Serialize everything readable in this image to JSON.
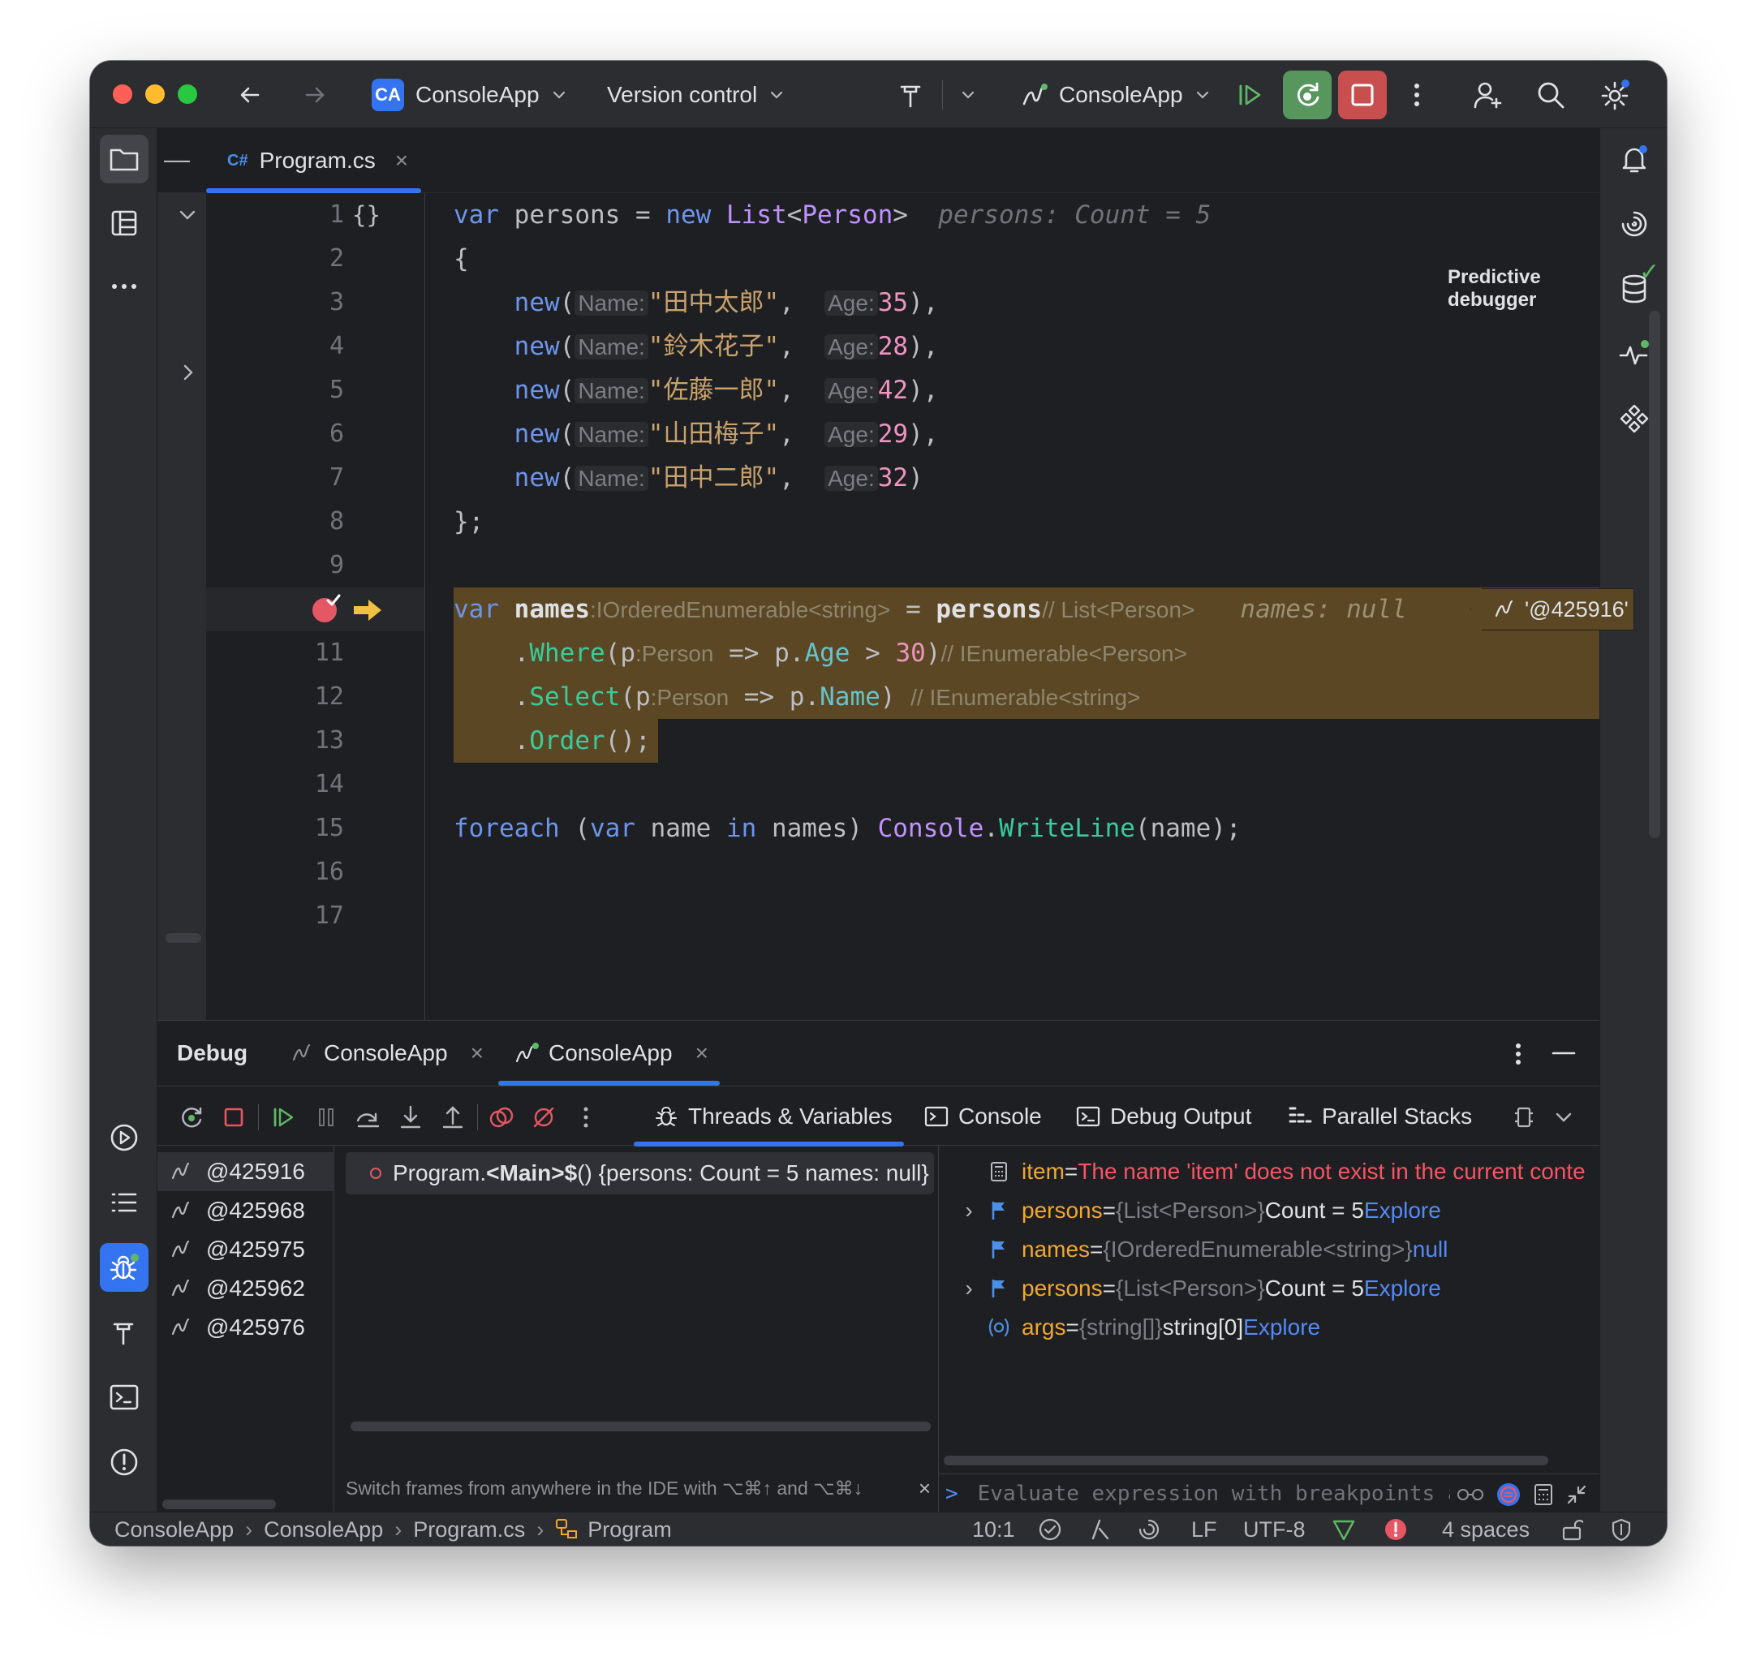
{
  "titlebar": {
    "project_badge": "CA",
    "project_name": "ConsoleApp",
    "vcs_label": "Version control",
    "run_config": "ConsoleApp"
  },
  "editor": {
    "tab_lang": "C#",
    "tab_name": "Program.cs",
    "tab_close": "×",
    "predictive_label": "Predictive debugger",
    "line_numbers": [
      "1",
      "2",
      "3",
      "4",
      "5",
      "6",
      "7",
      "8",
      "9",
      "",
      "11",
      "12",
      "13",
      "14",
      "15",
      "16",
      "17"
    ],
    "braces_marker": "{}",
    "thread_chip": "'@425916'",
    "code": {
      "l1_var": "var",
      "l1_name": " persons = ",
      "l1_new": "new",
      "l1_type1": " List",
      "l1_lt": "<",
      "l1_type2": "Person",
      "l1_gt": ">",
      "l1_val": "persons: Count = 5",
      "l2": "{",
      "rows": [
        {
          "s": "\"田中太郎\"",
          "n": "35",
          "end": "),"
        },
        {
          "s": "\"鈴木花子\"",
          "n": "28",
          "end": "),"
        },
        {
          "s": "\"佐藤一郎\"",
          "n": "42",
          "end": "),"
        },
        {
          "s": "\"山田梅子\"",
          "n": "29",
          "end": "),"
        },
        {
          "s": "\"田中二郎\"",
          "n": "32",
          "end": ")"
        }
      ],
      "new_kw": "new",
      "hint_name": "Name:",
      "hint_age": "Age:",
      "l8": "};",
      "l10_var": "var",
      "l10_name": " names",
      "l10_hint": ":IOrderedEnumerable<string>",
      "l10_eq": " = ",
      "l10_src": "persons",
      "l10_comment": "// List<Person>",
      "l10_val": "names: null",
      "l11_pre": "    .",
      "l11_m": "Where",
      "l11_a": "(p",
      "l11_hint": ":Person",
      "l11_b": " => p.",
      "l11_f": "Age",
      "l11_c": " > ",
      "l11_n": "30",
      "l11_d": ")",
      "l11_comment": "// IEnumerable<Person>",
      "l12_pre": "    .",
      "l12_m": "Select",
      "l12_a": "(p",
      "l12_hint": ":Person",
      "l12_b": " => p.",
      "l12_f": "Name",
      "l12_d": ")",
      "l12_comment": "// IEnumerable<string>",
      "l13_pre": "    .",
      "l13_m": "Order",
      "l13_d": "();",
      "l15_kw": "foreach",
      "l15_a": " (",
      "l15_var": "var",
      "l15_b": " name ",
      "l15_in": "in",
      "l15_c": " names) ",
      "l15_cls": "Console",
      "l15_dot": ".",
      "l15_m": "WriteLine",
      "l15_d": "(name);"
    }
  },
  "debug": {
    "title": "Debug",
    "tabs": [
      {
        "label": "ConsoleApp",
        "close": "×"
      },
      {
        "label": "ConsoleApp",
        "close": "×"
      }
    ],
    "view_tabs": [
      "Threads & Variables",
      "Console",
      "Debug Output",
      "Parallel Stacks"
    ],
    "threads": [
      "@425916",
      "@425968",
      "@425975",
      "@425962",
      "@425976"
    ],
    "frame": {
      "pre": "Program.",
      "main": "<Main>$",
      "post": "() {persons: Count = 5  names: null}"
    },
    "frame_hint": "Switch frames from anywhere in the IDE with ⌥⌘↑ and ⌥⌘↓",
    "frame_hint_close": "×",
    "variables": [
      {
        "name": "item",
        "eq": " = ",
        "err": "The name 'item' does not exist in the current conte"
      },
      {
        "name": "persons",
        "eq": " = ",
        "type": "{List<Person>}",
        "val": " Count = 5 ",
        "link": "Explore"
      },
      {
        "name": "names",
        "eq": " = ",
        "type": "{IOrderedEnumerable<string>}",
        "val": " ",
        "link": "null"
      },
      {
        "name": "persons",
        "eq": " = ",
        "type": "{List<Person>}",
        "val": " Count = 5 ",
        "link": "Explore"
      },
      {
        "name": "args",
        "eq": " = ",
        "type": "{string[]}",
        "val": " string[0] ",
        "link": "Explore"
      }
    ],
    "eval_prompt": ">",
    "eval_placeholder": "Evaluate expression with breakpoints and"
  },
  "statusbar": {
    "crumbs": [
      "ConsoleApp",
      "ConsoleApp",
      "Program.cs",
      "Program"
    ],
    "position": "10:1",
    "line_sep": "LF",
    "encoding": "UTF-8",
    "indent": "4 spaces"
  },
  "colors": {
    "accent": "#3574f0",
    "breakpoint": "#e55765",
    "exec_arrow": "#f0c040",
    "highlight": "#5b4724"
  }
}
